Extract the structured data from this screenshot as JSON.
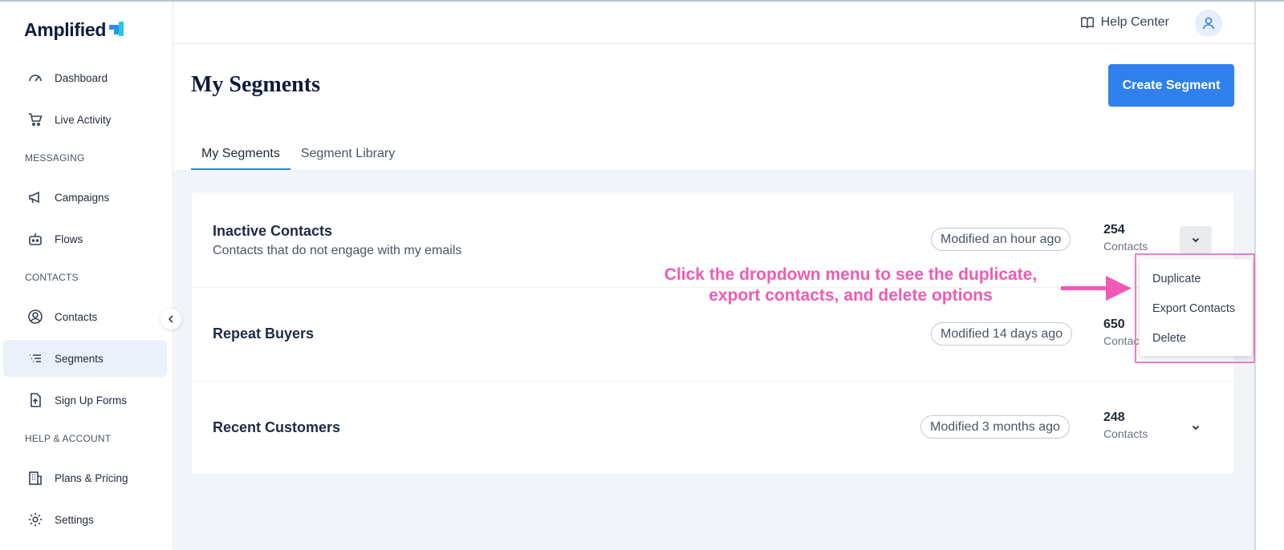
{
  "app": {
    "logo_text": "Amplified"
  },
  "sidebar": {
    "items": [
      {
        "label": "Dashboard",
        "icon": "gauge-icon"
      },
      {
        "label": "Live Activity",
        "icon": "cart-icon"
      },
      {
        "label": "Campaigns",
        "icon": "megaphone-icon"
      },
      {
        "label": "Flows",
        "icon": "robot-icon"
      },
      {
        "label": "Contacts",
        "icon": "user-circle-icon"
      },
      {
        "label": "Segments",
        "icon": "list-icon",
        "active": true
      },
      {
        "label": "Sign Up Forms",
        "icon": "file-upload-icon"
      },
      {
        "label": "Plans & Pricing",
        "icon": "building-icon"
      },
      {
        "label": "Settings",
        "icon": "gear-icon"
      }
    ],
    "sections": [
      "MESSAGING",
      "CONTACTS",
      "HELP & ACCOUNT"
    ]
  },
  "header": {
    "help_label": "Help Center"
  },
  "page": {
    "title": "My Segments",
    "create_button": "Create Segment",
    "tabs": [
      {
        "label": "My Segments",
        "active": true
      },
      {
        "label": "Segment Library"
      }
    ]
  },
  "segments": [
    {
      "name": "Inactive Contacts",
      "description": "Contacts that do not engage with my emails",
      "modified": "Modified an hour ago",
      "count": "254",
      "count_label": "Contacts"
    },
    {
      "name": "Repeat Buyers",
      "description": "",
      "modified": "Modified 14 days ago",
      "count": "650",
      "count_label": "Contacts"
    },
    {
      "name": "Recent Customers",
      "description": "",
      "modified": "Modified 3 months ago",
      "count": "248",
      "count_label": "Contacts"
    }
  ],
  "dropdown": {
    "items": [
      "Duplicate",
      "Export Contacts",
      "Delete"
    ]
  },
  "annotation": {
    "line1": "Click the dropdown menu to see the duplicate,",
    "line2": "export contacts, and delete options",
    "color": "#f05ab5"
  },
  "colors": {
    "accent": "#2f80ed",
    "brand_navy": "#0f1b3d",
    "annotation_pink": "#f05ab5"
  }
}
